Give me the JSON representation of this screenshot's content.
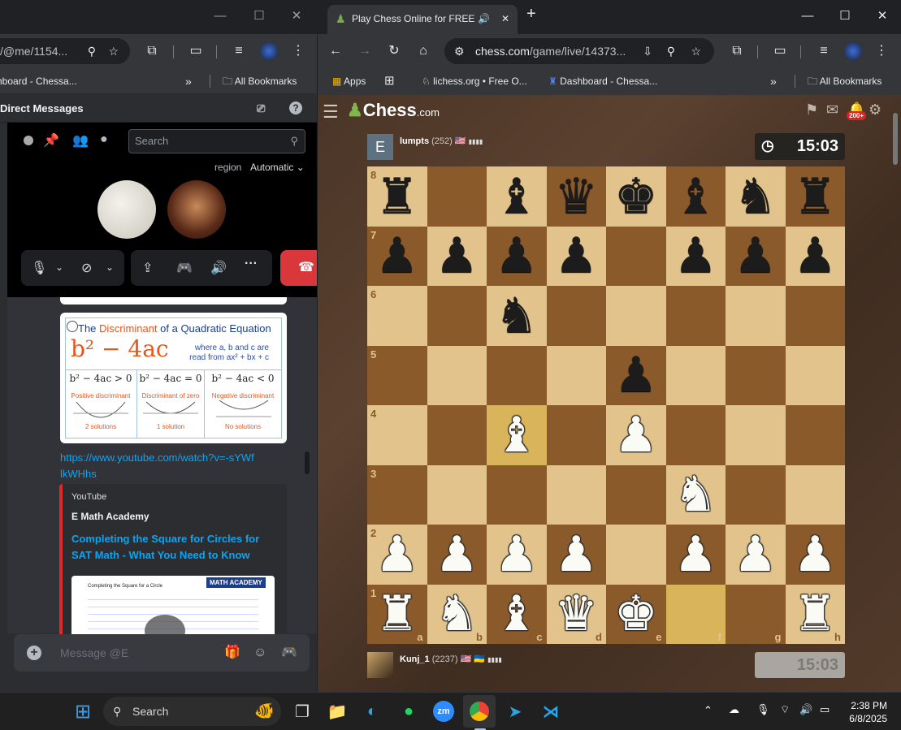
{
  "left_window": {
    "url": "/@me/1154...",
    "bookmark_1": "hboard - Chessa...",
    "all_bookmarks": "All Bookmarks",
    "dm_header": "Direct Messages",
    "call": {
      "search_placeholder": "Search",
      "region_label": "region",
      "region_value": "Automatic"
    },
    "chat": {
      "image_card": {
        "title_prefix": "The ",
        "title_word": "Discriminant",
        "title_suffix": " of a Quadratic Equation",
        "formula": "b² − 4ac",
        "note": "where a, b and c are read from ax² + bx + c",
        "cases": [
          {
            "expr": "b² − 4ac > 0",
            "label": "Positive discriminant",
            "sols": "2 solutions"
          },
          {
            "expr": "b² − 4ac = 0",
            "label": "Discriminant of zero",
            "sols": "1 solution"
          },
          {
            "expr": "b² − 4ac < 0",
            "label": "Negative discriminant",
            "sols": "No solutions"
          }
        ]
      },
      "link": "https://www.youtube.com/watch?v=-sYWflkWHhs",
      "embed": {
        "provider": "YouTube",
        "author": "E Math Academy",
        "title": "Completing the Square for Circles for SAT Math - What You Need to Know",
        "thumb_badge": "MATH ACADEMY",
        "thumb_heading": "Completing the Square for a Circle"
      },
      "message_placeholder": "Message @E"
    }
  },
  "right_window": {
    "tab_title": "Play Chess Online for FREE",
    "url_host": "chess.com",
    "url_path": "/game/live/14373...",
    "bookmarks": [
      "Apps",
      "lichess.org • Free O...",
      "Dashboard - Chessa..."
    ],
    "all_bookmarks": "All Bookmarks",
    "site": {
      "logo": "Chess",
      "logo_suffix": ".com",
      "notif_badge": "200+"
    },
    "top_player": {
      "avatar_letter": "E",
      "name": "lumpts",
      "rating": "(252)",
      "clock": "15:03"
    },
    "bottom_player": {
      "name": "Kunj_1",
      "rating": "(2237)",
      "clock": "15:03"
    },
    "board": {
      "ranks": [
        "8",
        "7",
        "6",
        "5",
        "4",
        "3",
        "2",
        "1"
      ],
      "files": [
        "a",
        "b",
        "c",
        "d",
        "e",
        "f",
        "g",
        "h"
      ],
      "rows": [
        [
          "bR",
          "",
          "bB",
          "bQ",
          "bK",
          "bB",
          "bN",
          "bR"
        ],
        [
          "bP",
          "bP",
          "bP",
          "bP",
          "",
          "bP",
          "bP",
          "bP"
        ],
        [
          "",
          "",
          "bN",
          "",
          "",
          "",
          "",
          ""
        ],
        [
          "",
          "",
          "",
          "",
          "bP",
          "",
          "",
          ""
        ],
        [
          "",
          "",
          "wB",
          "",
          "wP",
          "",
          "",
          ""
        ],
        [
          "",
          "",
          "",
          "",
          "",
          "wN",
          "",
          ""
        ],
        [
          "wP",
          "wP",
          "wP",
          "wP",
          "",
          "wP",
          "wP",
          "wP"
        ],
        [
          "wR",
          "wN",
          "wB",
          "wQ",
          "wK",
          "",
          "",
          "wR"
        ]
      ],
      "highlights": [
        "c4",
        "f1"
      ]
    }
  },
  "taskbar": {
    "search_label": "Search",
    "time": "2:38 PM",
    "date": "6/8/2025"
  }
}
